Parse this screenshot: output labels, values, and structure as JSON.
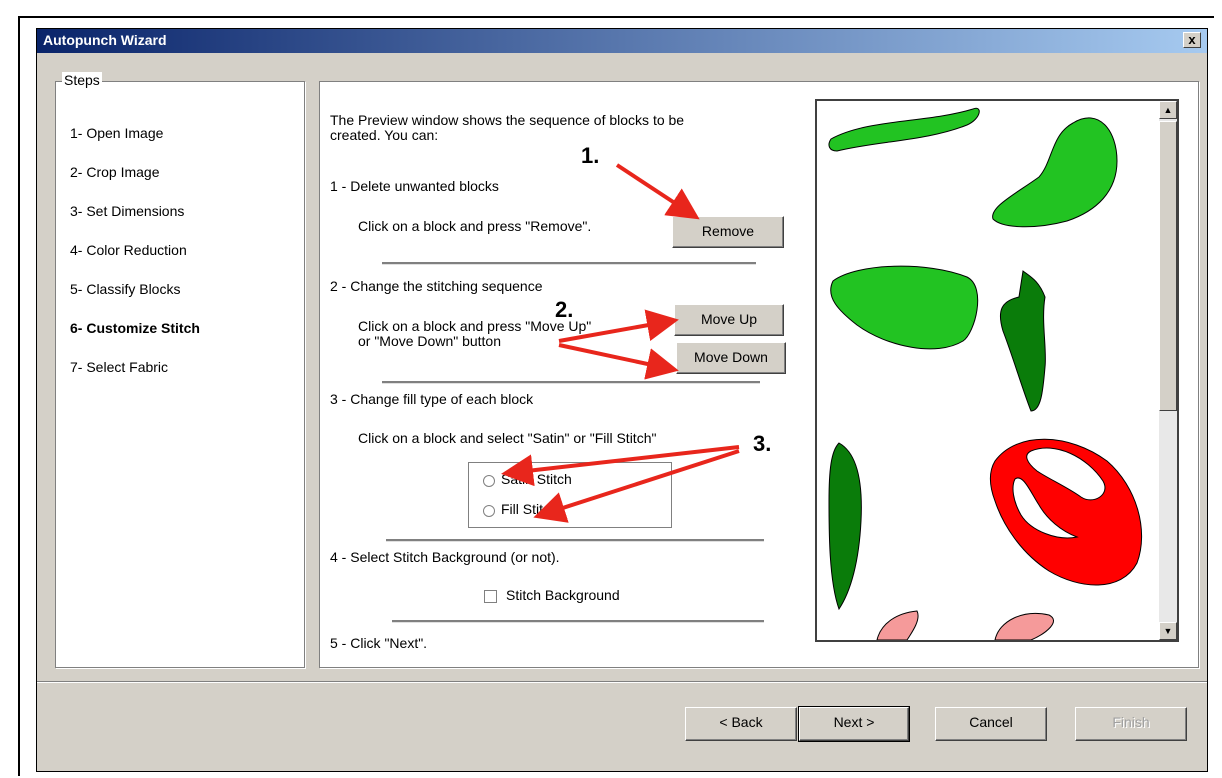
{
  "window": {
    "title": "Autopunch Wizard",
    "close_label": "x"
  },
  "steps": {
    "legend": "Steps",
    "items": [
      {
        "label": "1- Open Image"
      },
      {
        "label": "2- Crop Image"
      },
      {
        "label": "3- Set Dimensions"
      },
      {
        "label": "4- Color Reduction"
      },
      {
        "label": "5- Classify Blocks"
      },
      {
        "label": "6- Customize Stitch",
        "active": true
      },
      {
        "label": "7- Select Fabric"
      }
    ]
  },
  "content": {
    "intro_line1": "The Preview window shows the sequence of blocks to be",
    "intro_line2": "created. You can:",
    "section1": {
      "heading": "1 -  Delete unwanted blocks",
      "instruction": "Click on a block and press \"Remove\".",
      "button": "Remove"
    },
    "section2": {
      "heading": "2 -  Change the stitching sequence",
      "instruction_line1": "Click on a block and press \"Move Up\"",
      "instruction_line2": "or \"Move Down\" button",
      "move_up": "Move Up",
      "move_down": "Move Down"
    },
    "section3": {
      "heading": "3 -  Change fill type of each block",
      "instruction": "Click on a block and select \"Satin\" or \"Fill Stitch\"",
      "satin_label": "Satin Stitch",
      "fill_label": "Fill Stitch"
    },
    "section4": {
      "heading": "4 -  Select Stitch Background (or not).",
      "checkbox_label": "Stitch Background"
    },
    "section5": {
      "heading": "5 -  Click \"Next\"."
    }
  },
  "annotations": {
    "a1": "1.",
    "a2": "2.",
    "a3": "3."
  },
  "footer": {
    "back": "< Back",
    "next": "Next >",
    "cancel": "Cancel",
    "finish": "Finish"
  },
  "colors": {
    "arrow": "#e8261c",
    "leaf_green": "#22c322",
    "dark_green": "#0a7c0a",
    "red": "#ff0000",
    "pink": "#f59a9a"
  },
  "icons": {
    "scroll_up": "up-arrow-icon",
    "scroll_down": "down-arrow-icon"
  }
}
